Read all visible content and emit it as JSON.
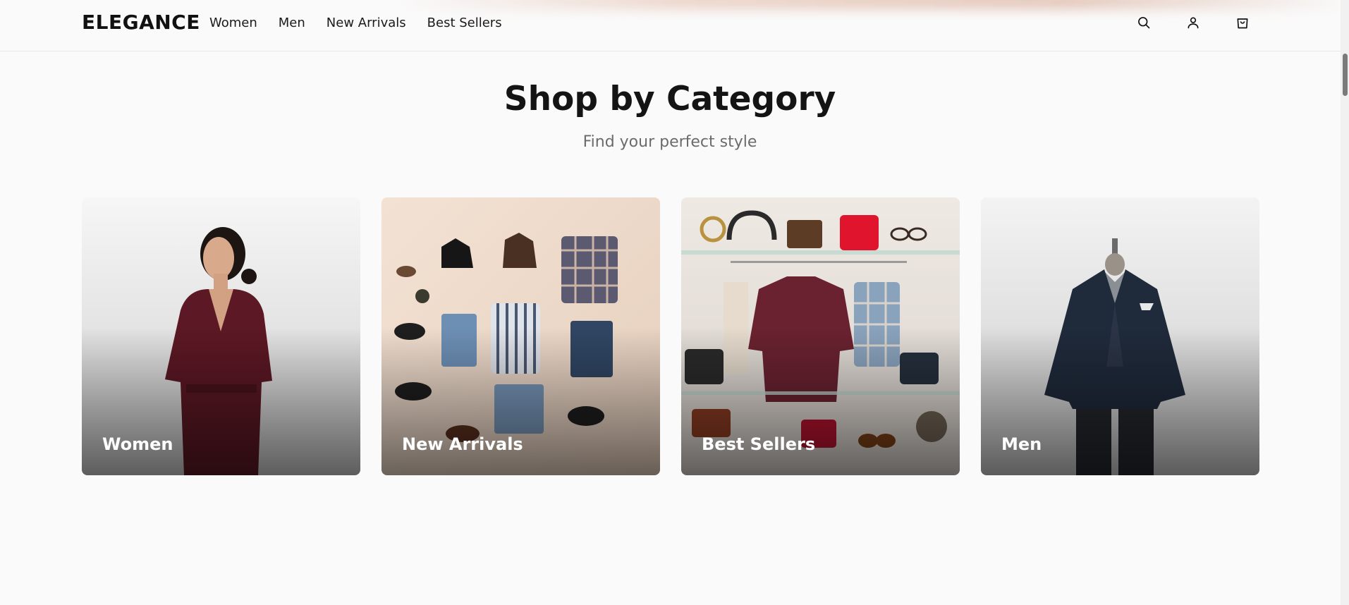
{
  "header": {
    "logo": "ELEGANCE",
    "nav": [
      "Women",
      "Men",
      "New Arrivals",
      "Best Sellers"
    ],
    "icons": [
      "search-icon",
      "user-icon",
      "shopping-bag-icon"
    ]
  },
  "section": {
    "title": "Shop by Category",
    "subtitle": "Find your perfect style"
  },
  "categories": [
    {
      "label": "Women",
      "image": "woman in burgundy wrap dress"
    },
    {
      "label": "New Arrivals",
      "image": "flat lay of clothing and accessories"
    },
    {
      "label": "Best Sellers",
      "image": "shelf display with bags and sweaters"
    },
    {
      "label": "Men",
      "image": "navy suit on mannequin"
    }
  ],
  "colors": {
    "background": "#fafafa",
    "text": "#111111",
    "subtitle": "#6b6b6b"
  }
}
